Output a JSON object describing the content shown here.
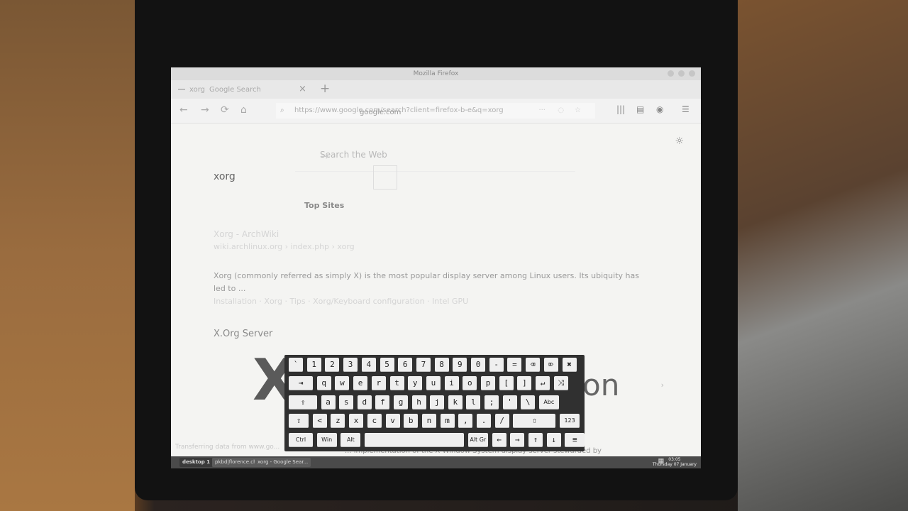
{
  "window": {
    "title": "Mozilla Firefox"
  },
  "tab": {
    "label_primary": "xorg",
    "label_secondary": "Google Search",
    "close": "×",
    "new_tab": "+"
  },
  "nav": {
    "back": "←",
    "forward": "→",
    "reload": "⟳",
    "home": "⌂",
    "url": "https://www.google.com/search?client=firefox-b-e&q=xorg",
    "url_overlay": "google.com",
    "menu_dots": "···"
  },
  "page": {
    "search_placeholder": "Search the Web",
    "search_arrow": "→",
    "query": "xorg",
    "top_sites": "Top Sites",
    "result1_title": "Xorg - ArchWiki",
    "result1_url": "wiki.archlinux.org › index.php › xorg",
    "snippet": "Xorg (commonly referred as simply X) is the most popular display server among Linux users. Its ubiquity has led to ...",
    "sublinks": "Installation · Xorg · Tips · Xorg/Keyboard configuration · Intel GPU",
    "result2_title": "X.Org Server",
    "logo_fragment": "on",
    "chevron": "›",
    "status": "Transferring data from www.go...",
    "bottom_text": "... implementation of the X Window System display server stewarded by"
  },
  "taskbar": {
    "desktop": "desktop 1",
    "task1": "pkbd|florence.ch",
    "task2": "xorg - Google Sear...",
    "time": "03:05",
    "date": "Thursday 07 January"
  },
  "keyboard": {
    "row1": [
      "`",
      "1",
      "2",
      "3",
      "4",
      "5",
      "6",
      "7",
      "8",
      "9",
      "0",
      "-",
      "=",
      "⌫",
      "⌦",
      "✖"
    ],
    "row2": [
      "⇥",
      "q",
      "w",
      "e",
      "r",
      "t",
      "y",
      "u",
      "i",
      "o",
      "p",
      "[",
      "]",
      "↵",
      "⤨"
    ],
    "row3": [
      "⇪",
      "a",
      "s",
      "d",
      "f",
      "g",
      "h",
      "j",
      "k",
      "l",
      ";",
      "'",
      "\\",
      "Abc"
    ],
    "row4": [
      "⇧",
      "<",
      "z",
      "x",
      "c",
      "v",
      "b",
      "n",
      "m",
      ",",
      ".",
      "/",
      "⇧",
      "123"
    ],
    "row5": [
      "Ctrl",
      "Win",
      "Alt",
      "",
      "Alt Gr",
      "←",
      "→",
      "↑",
      "↓",
      "≡"
    ]
  }
}
